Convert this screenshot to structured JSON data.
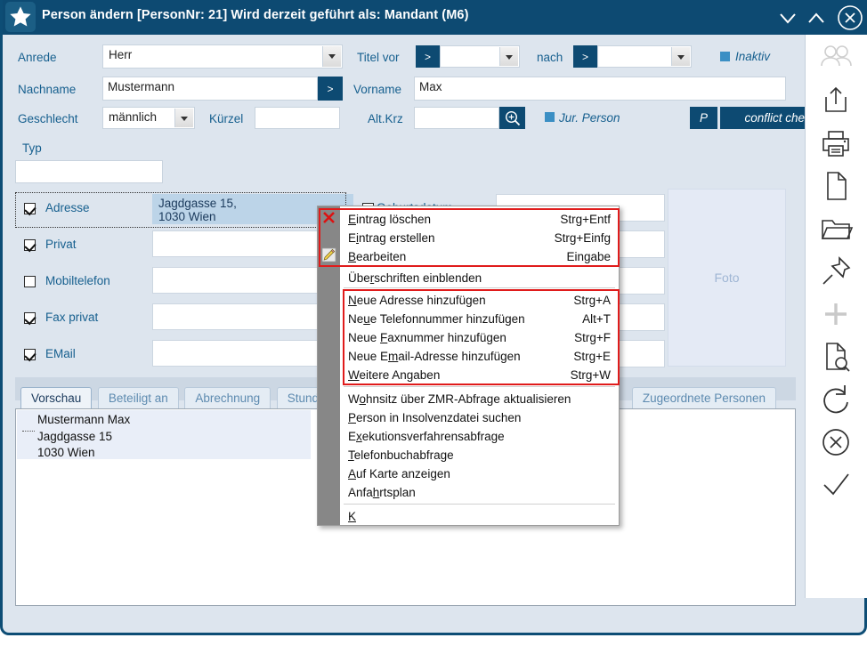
{
  "window": {
    "title": "Person ändern  [PersonNr: 21] Wird derzeit geführt als: Mandant (M6)",
    "star_icon": "star-icon",
    "minimize_label": "chevron-down-icon",
    "maximize_label": "chevron-up-icon",
    "close_label": "close-circle-icon",
    "accent": "#0d4a72",
    "background": "#dde5ee"
  },
  "form": {
    "anrede": {
      "label": "Anrede",
      "value": "Herr"
    },
    "titel_vor": {
      "label": "Titel vor",
      "button": ">",
      "value": ""
    },
    "nach": {
      "label": "nach",
      "button": ">",
      "value": ""
    },
    "inaktiv": {
      "label": "Inaktiv",
      "checked": true
    },
    "nachname": {
      "label": "Nachname",
      "value": "Mustermann",
      "button": ">"
    },
    "vorname": {
      "label": "Vorname",
      "value": "Max"
    },
    "geschlecht": {
      "label": "Geschlecht",
      "value": "männlich"
    },
    "kuerzel": {
      "label": "Kürzel",
      "value": ""
    },
    "alt_krz": {
      "label": "Alt.Krz",
      "value": "",
      "search_icon": "magnifier-plus-icon"
    },
    "jur_person": {
      "label": "Jur. Person",
      "checked": true
    },
    "p_button": "P",
    "conflict_check_button": "conflict check",
    "typ": {
      "label": "Typ",
      "value": ""
    }
  },
  "contacts": {
    "rows": [
      {
        "label": "Adresse",
        "checked": true,
        "value": "Jagdgasse 15,\n1030 Wien",
        "selected": true
      },
      {
        "label": "Privat",
        "checked": true,
        "value": "",
        "selected": false
      },
      {
        "label": "Mobiltelefon",
        "checked": false,
        "value": "",
        "selected": false
      },
      {
        "label": "Fax privat",
        "checked": true,
        "value": "",
        "selected": false
      },
      {
        "label": "EMail",
        "checked": true,
        "value": "",
        "selected": false
      }
    ],
    "right_rows": [
      {
        "label": "Geburtsdatum",
        "checked": true,
        "value": ""
      },
      {
        "label": "",
        "checked": false,
        "value": ""
      },
      {
        "label": "",
        "checked": false,
        "value": ""
      },
      {
        "label": "",
        "checked": false,
        "value": ""
      },
      {
        "label": "",
        "checked": false,
        "value": ""
      }
    ],
    "foto_placeholder": "Foto"
  },
  "tabs": {
    "items": [
      {
        "label": "Vorschau",
        "active": true
      },
      {
        "label": "Beteiligt an",
        "active": false
      },
      {
        "label": "Abrechnung",
        "active": false
      },
      {
        "label": "Stunden",
        "active": false
      }
    ],
    "right_tab": "Zugeordnete Personen",
    "nav_prev": "prev-arrow-icon",
    "nav_next": "next-arrow-icon"
  },
  "preview": {
    "lines": [
      "Mustermann Max",
      "Jagdgasse 15",
      "1030 Wien"
    ]
  },
  "context_menu": {
    "groups": [
      {
        "highlighted": true,
        "items": [
          {
            "label": "Eintrag löschen",
            "accel": "E",
            "shortcut": "Strg+Entf",
            "icon": "delete-x-icon"
          },
          {
            "label": "Eintrag erstellen",
            "accel": "i",
            "shortcut": "Strg+Einfg",
            "icon": ""
          },
          {
            "label": "Bearbeiten",
            "accel": "B",
            "shortcut": "Eingabe",
            "icon": "pencil-edit-icon"
          }
        ]
      },
      {
        "highlighted": false,
        "items": [
          {
            "label": "Überschriften einblenden",
            "accel": "r",
            "shortcut": "",
            "icon": ""
          }
        ]
      },
      {
        "highlighted": true,
        "items": [
          {
            "label": "Neue Adresse hinzufügen",
            "accel": "N",
            "shortcut": "Strg+A",
            "icon": ""
          },
          {
            "label": "Neue Telefonnummer hinzufügen",
            "accel": "u",
            "shortcut": "Alt+T",
            "icon": ""
          },
          {
            "label": "Neue Faxnummer hinzufügen",
            "accel": "F",
            "shortcut": "Strg+F",
            "icon": ""
          },
          {
            "label": "Neue Email-Adresse hinzufügen",
            "accel": "m",
            "shortcut": "Strg+E",
            "icon": ""
          },
          {
            "label": "Weitere Angaben",
            "accel": "W",
            "shortcut": "Strg+W",
            "icon": ""
          }
        ]
      },
      {
        "highlighted": false,
        "items": [
          {
            "label": "Wohnsitz über ZMR-Abfrage aktualisieren",
            "accel": "o",
            "shortcut": "",
            "icon": ""
          },
          {
            "label": "Person in Insolvenzdatei suchen",
            "accel": "P",
            "shortcut": "",
            "icon": ""
          },
          {
            "label": "Exekutionsverfahrensabfrage",
            "accel": "x",
            "shortcut": "",
            "icon": ""
          },
          {
            "label": "Telefonbuchabfrage",
            "accel": "T",
            "shortcut": "",
            "icon": ""
          },
          {
            "label": "Auf Karte anzeigen",
            "accel": "A",
            "shortcut": "",
            "icon": ""
          },
          {
            "label": "Anfahrtsplan",
            "accel": "h",
            "shortcut": "",
            "icon": ""
          }
        ]
      },
      {
        "highlighted": false,
        "items": [
          {
            "label": "Keine Adresse bei ERV Eingabe versenden",
            "accel": "K",
            "shortcut": "",
            "icon": ""
          }
        ]
      }
    ],
    "highlight_color": "#e01b1b"
  },
  "rail": {
    "icons": [
      {
        "name": "people-icon",
        "disabled": true
      },
      {
        "name": "share-upload-icon",
        "disabled": false
      },
      {
        "name": "printer-icon",
        "disabled": false
      },
      {
        "name": "document-icon",
        "disabled": false
      },
      {
        "name": "folder-icon",
        "disabled": false
      },
      {
        "name": "pin-icon",
        "disabled": false
      },
      {
        "name": "plus-icon",
        "disabled": true
      },
      {
        "name": "document-search-icon",
        "disabled": false
      },
      {
        "name": "refresh-icon",
        "disabled": false
      },
      {
        "name": "cancel-circle-icon",
        "disabled": false
      },
      {
        "name": "check-icon",
        "disabled": false
      }
    ]
  }
}
